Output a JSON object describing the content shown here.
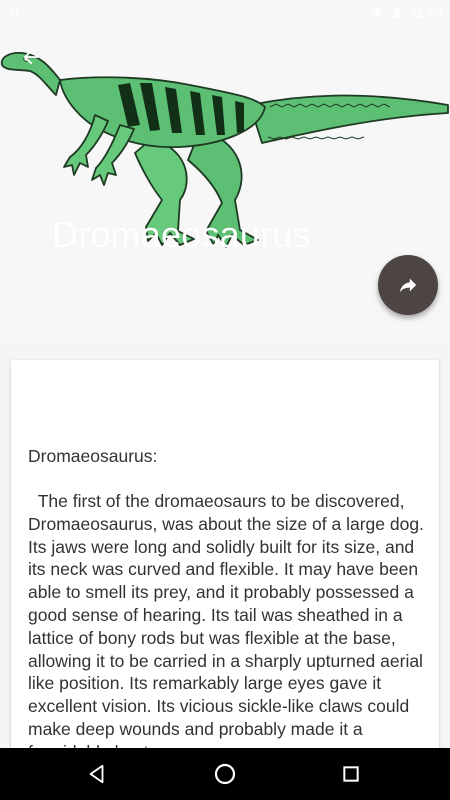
{
  "status_bar": {
    "left_indicator": "N",
    "time": "11:53"
  },
  "header": {
    "title": "Dromaeosaurus",
    "back_icon": "arrow-left-icon",
    "image": "green-dinosaur-illustration",
    "dino_color": "#5cbf73"
  },
  "share": {
    "icon": "share-arrow-icon",
    "color": "#4d4542"
  },
  "article": {
    "heading": "Dromaeosaurus:",
    "body": "  The first of the dromaeosaurs to be discovered, Dromaeosaurus, was about the size of a large dog. Its jaws were long and solidly built for its size, and its neck was curved and flexible. It may have been able to smell its prey, and it probably possessed a good sense of hearing. Its tail was sheathed in a lattice of bony rods but was flexible at the base, allowing it to be carried in a sharply upturned aerial like position. Its remarkably large eyes gave it excellent vision. Its vicious sickle-like claws could make deep wounds and probably made it a formidable hunter."
  },
  "nav_bar": {
    "back": "triangle-back-icon",
    "home": "circle-home-icon",
    "recents": "square-recents-icon"
  }
}
